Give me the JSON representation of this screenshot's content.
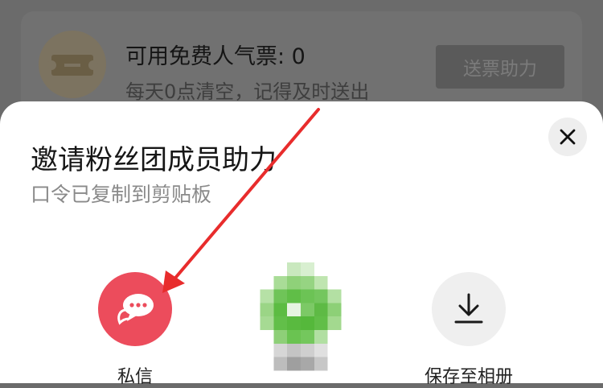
{
  "background_card": {
    "title": "可用免费人气票: 0",
    "subtitle": "每天0点清空，记得及时送出",
    "button_label": "送票助力"
  },
  "sheet": {
    "title": "邀请粉丝团成员助力",
    "subtitle": "口令已复制到剪贴板",
    "close_icon": "close-icon",
    "share_options": [
      {
        "label": "私信",
        "icon": "chat-bubble-icon",
        "color": "#ec4c5c"
      },
      {
        "label": "",
        "icon": "wechat-icon",
        "color": "#4fbf3a"
      },
      {
        "label": "保存至相册",
        "icon": "download-icon",
        "color": "#efefef"
      }
    ]
  },
  "annotation": {
    "color": "#e82c2c"
  }
}
